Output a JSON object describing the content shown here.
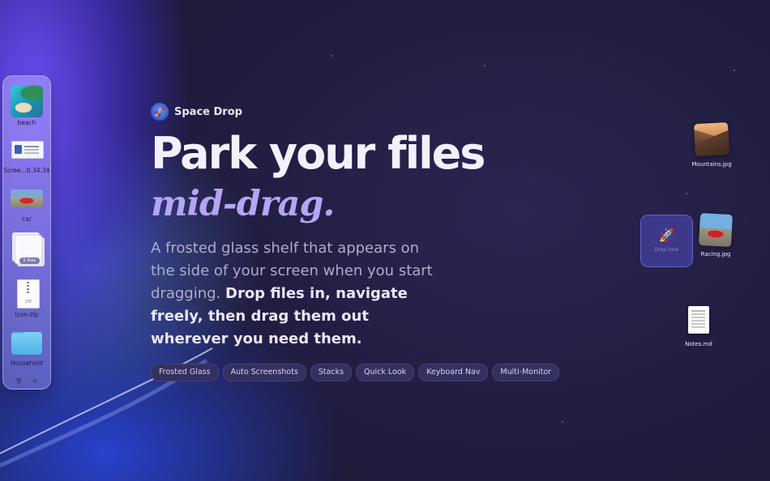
{
  "shelf": {
    "items": [
      {
        "label": "beach",
        "icon": "beach-photo-thumbnail"
      },
      {
        "label": "Scree...0.34.34",
        "icon": "screenshot-thumbnail"
      },
      {
        "label": "car",
        "icon": "car-photo-thumbnail"
      },
      {
        "label": "",
        "icon": "file-stack-thumbnail",
        "badge": "3 files"
      },
      {
        "label": "icon-zip",
        "icon": "zip-archive-icon"
      },
      {
        "label": "Household",
        "icon": "folder-icon"
      }
    ],
    "footer_left_icon": "trash-icon",
    "footer_right_icon": "settings-icon"
  },
  "hero": {
    "brand": "Space Drop",
    "headline": "Park your files",
    "subhead": "mid-drag.",
    "description_plain": "A frosted glass shelf that appears on the side of your screen when you start dragging.",
    "description_bold": "Drop files in, navigate freely, then drag them out wherever you need them."
  },
  "tags": [
    "Frosted Glass",
    "Auto Screenshots",
    "Stacks",
    "Quick Look",
    "Keyboard Nav",
    "Multi-Monitor"
  ],
  "desktop": {
    "mountains_label": "Mountains.jpg",
    "racing_label": "Racing.jpg",
    "notes_label": "Notes.md",
    "drop_zone_label": "Drop here"
  },
  "colors": {
    "background": "#1d1a3a",
    "accent_purple": "#b6a4f5",
    "tag_bg": "#34305f",
    "shelf_glass": "#b9aaff"
  }
}
